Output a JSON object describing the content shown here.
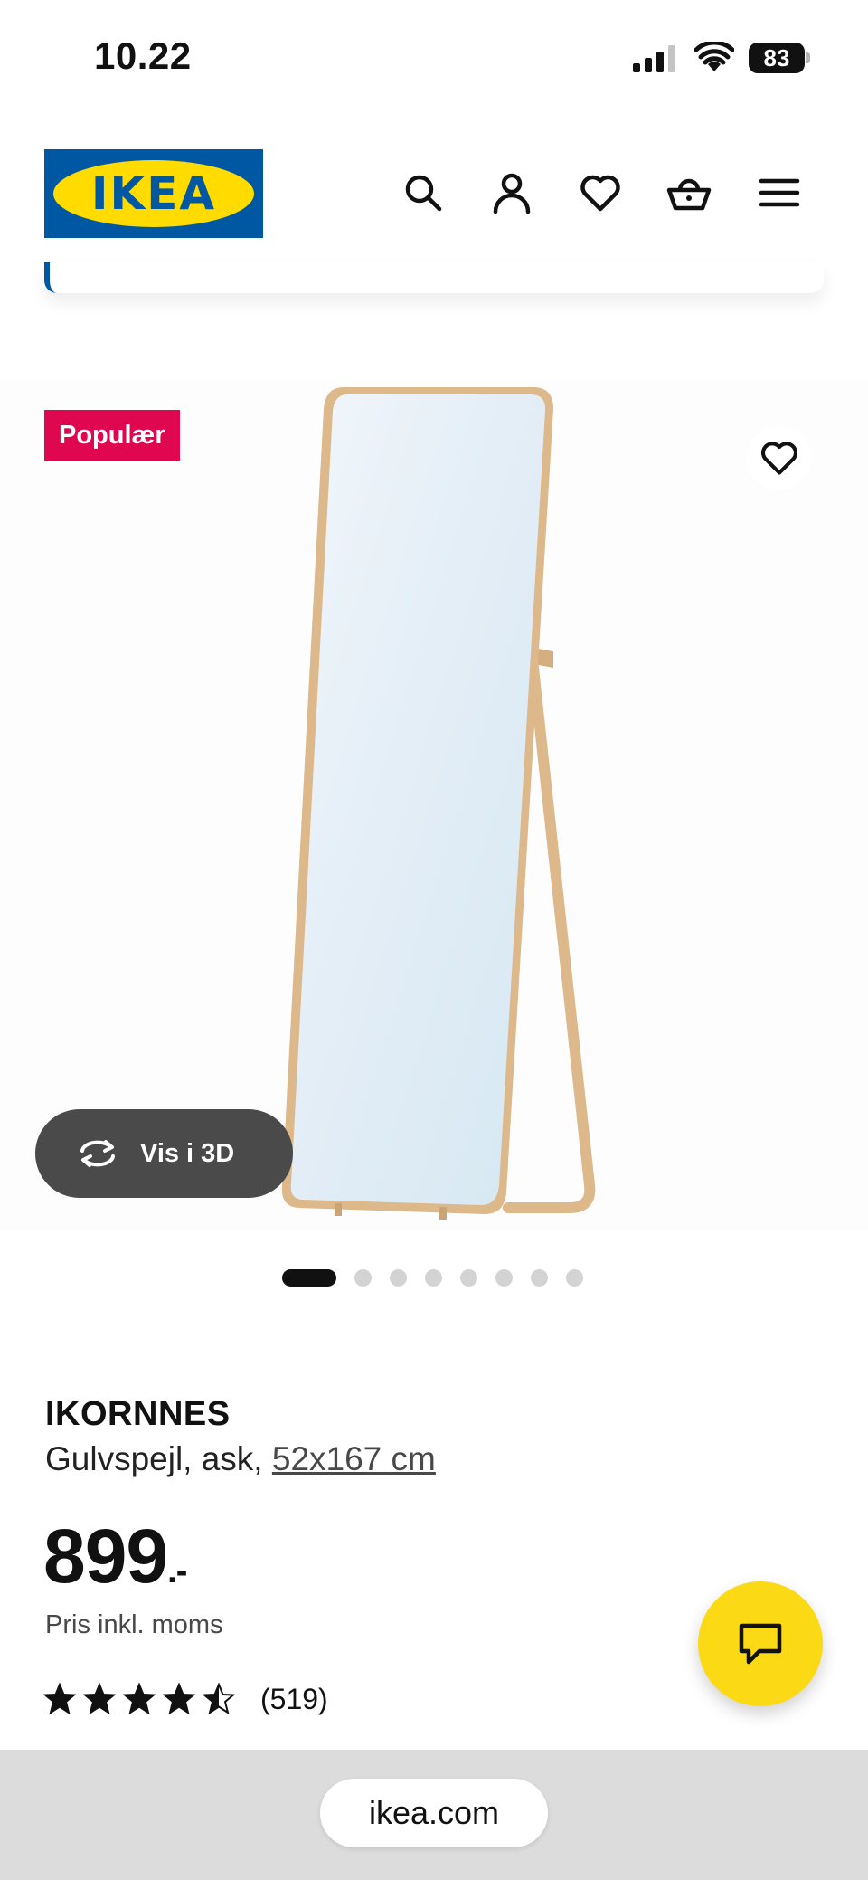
{
  "status_bar": {
    "time": "10.22",
    "battery": "83"
  },
  "header": {
    "logo_text": "IKEA",
    "icons": [
      "search-icon",
      "account-icon",
      "heart-icon",
      "basket-icon",
      "menu-icon"
    ]
  },
  "gallery": {
    "badge": "Populær",
    "view_3d_label": "Vis i 3D",
    "image_count": 8,
    "active_index": 0
  },
  "product": {
    "name": "IKORNNES",
    "description": "Gulvspejl, ask, ",
    "size": "52x167 cm",
    "price": "899",
    "price_suffix": ".-",
    "price_note": "Pris inkl. moms",
    "rating": 4.5,
    "rating_count": "(519)"
  },
  "browser": {
    "url": "ikea.com"
  },
  "colors": {
    "ikea_blue": "#0058a3",
    "ikea_yellow": "#ffdb00",
    "badge_red": "#e00751",
    "chat_yellow": "#fbd914"
  }
}
